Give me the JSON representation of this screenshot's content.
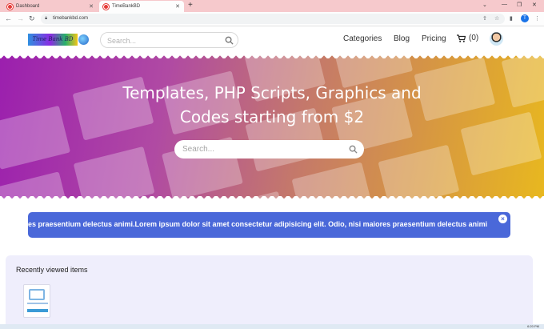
{
  "browser": {
    "tabs": [
      {
        "title": "Dashboard",
        "active": false
      },
      {
        "title": "TimeBankBD",
        "active": true
      }
    ],
    "url": "timebankbd.com",
    "profile_initial": "T"
  },
  "site": {
    "logo_text": "Time Bank BD",
    "search_placeholder": "Search...",
    "nav": {
      "categories": "Categories",
      "blog": "Blog",
      "pricing": "Pricing",
      "cart_count": "(0)"
    }
  },
  "hero": {
    "title": "Templates, PHP Scripts, Graphics and Codes starting from $2",
    "search_placeholder": "Search..."
  },
  "banner": {
    "text": "es praesentium delectus animi.Lorem ipsum dolor sit amet consectetur adipisicing elit. Odio, nisi maiores praesentium delectus animi"
  },
  "recent": {
    "title": "Recently viewed items"
  },
  "taskbar": {
    "clock": "6:20 PM"
  },
  "colors": {
    "tabstrip": "#f6c9cc",
    "banner": "#4a68d9",
    "recent_bg": "#efeefc"
  },
  "icons": [
    "lock-icon",
    "search-icon",
    "cart-icon",
    "close-icon",
    "star-icon",
    "menu-icon"
  ]
}
